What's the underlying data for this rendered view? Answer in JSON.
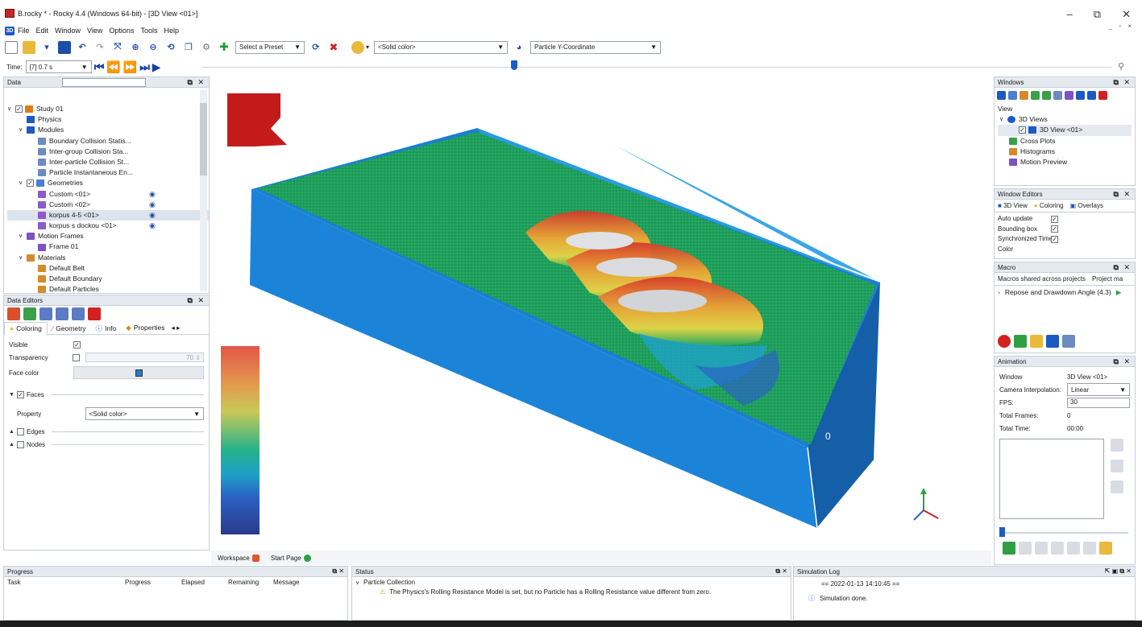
{
  "window": {
    "title": "B.rocky * - Rocky 4.4 (Windows 64-bit) - [3D View <01>]",
    "min": "–",
    "restore": "⧉",
    "close": "✕"
  },
  "menu": [
    "File",
    "Edit",
    "Window",
    "View",
    "Options",
    "Tools",
    "Help"
  ],
  "toolbar": {
    "preset_label": "Select a Preset",
    "color_label": "<Solid color>",
    "property_label": "Particle Y-Coordinate"
  },
  "time": {
    "label": "Time:",
    "value": "[7] 0.7 s"
  },
  "data_panel": {
    "title": "Data",
    "tree": [
      {
        "label": "Study 01",
        "level": 0,
        "caret": "∨",
        "check": true,
        "icon": "#e07b1a"
      },
      {
        "label": "Physics",
        "level": 1,
        "icon": "#1d59c4"
      },
      {
        "label": "Modules",
        "level": 1,
        "caret": "∨",
        "icon": "#1d59c4"
      },
      {
        "label": "Boundary Collision Statis...",
        "level": 2,
        "icon": "#6d8bbf"
      },
      {
        "label": "Inter-group Collision Sta...",
        "level": 2,
        "icon": "#6d8bbf"
      },
      {
        "label": "Inter-particle Collision St...",
        "level": 2,
        "icon": "#6d8bbf"
      },
      {
        "label": "Particle Instantaneous En...",
        "level": 2,
        "icon": "#6d8bbf"
      },
      {
        "label": "Geometries",
        "level": 1,
        "caret": "∨",
        "check": true,
        "icon": "#4d7fd0"
      },
      {
        "label": "Custom <01>",
        "level": 2,
        "icon": "#8a5cc9",
        "eye": true
      },
      {
        "label": "Custom <02>",
        "level": 2,
        "icon": "#8a5cc9",
        "eye": true
      },
      {
        "label": "korpus 4-5 <01>",
        "level": 2,
        "icon": "#8a5cc9",
        "eye": true,
        "selected": true
      },
      {
        "label": "korpus s dockou <01>",
        "level": 2,
        "icon": "#8a5cc9",
        "eye": true
      },
      {
        "label": "Motion Frames",
        "level": 1,
        "caret": "∨",
        "icon": "#7c52c4"
      },
      {
        "label": "Frame 01",
        "level": 2,
        "icon": "#7c52c4"
      },
      {
        "label": "Materials",
        "level": 1,
        "caret": "∨",
        "icon": "#d38b2b"
      },
      {
        "label": "Default Belt",
        "level": 2,
        "icon": "#d38b2b"
      },
      {
        "label": "Default Boundary",
        "level": 2,
        "icon": "#d38b2b"
      },
      {
        "label": "Default Particles",
        "level": 2,
        "icon": "#d38b2b"
      }
    ]
  },
  "data_editors": {
    "title": "Data Editors",
    "tabs": [
      "Coloring",
      "Geometry",
      "Info",
      "Properties"
    ],
    "visible_label": "Visible",
    "transparency_label": "Transparency",
    "transparency_value": "70",
    "face_color_label": "Face color",
    "faces_label": "Faces",
    "property_label": "Property",
    "property_value": "<Solid color>",
    "edges_label": "Edges",
    "nodes_label": "Nodes",
    "face_color_hex": "#1b7fd1"
  },
  "workspace_tabs": {
    "workspace": "Workspace",
    "start": "Start Page"
  },
  "windows_panel": {
    "title": "Windows",
    "section": "View",
    "items": [
      "3D Views",
      "3D View <01>",
      "Cross Plots",
      "Histograms",
      "Motion Preview"
    ]
  },
  "window_editors": {
    "title": "Window Editors",
    "tabs": [
      "3D View",
      "Coloring",
      "Overlays"
    ],
    "rows": [
      {
        "label": "Auto update"
      },
      {
        "label": "Bounding box"
      },
      {
        "label": "Synchronized Time"
      },
      {
        "label": "Color"
      }
    ]
  },
  "macro": {
    "title": "Macro",
    "tabs": [
      "Macros shared across projects",
      "Project ma"
    ],
    "item": "Repose and Drawdown Angle (4.3)"
  },
  "animation": {
    "title": "Animation",
    "window_label": "Window",
    "window_value": "3D View <01>",
    "interp_label": "Camera Interpolation:",
    "interp_value": "Linear",
    "fps_label": "FPS:",
    "fps_value": "30",
    "frames_label": "Total Frames:",
    "frames_value": "0",
    "time_label": "Total Time:",
    "time_value": "00:00"
  },
  "progress": {
    "title": "Progress",
    "columns": [
      "Task",
      "Progress",
      "Elapsed",
      "Remaining",
      "Message"
    ]
  },
  "status": {
    "title": "Status",
    "group": "Particle Collection",
    "message": "The Physics's Rolling Resistance Model is set, but no Particle has a Rolling Resistance value different from zero."
  },
  "simlog": {
    "title": "Simulation Log",
    "timestamp": "== 2022-01-13 14:10:45 ==",
    "message": "Simulation done."
  },
  "viewport": {
    "axis_zero": "0",
    "logo_color": "#c41a1a"
  }
}
